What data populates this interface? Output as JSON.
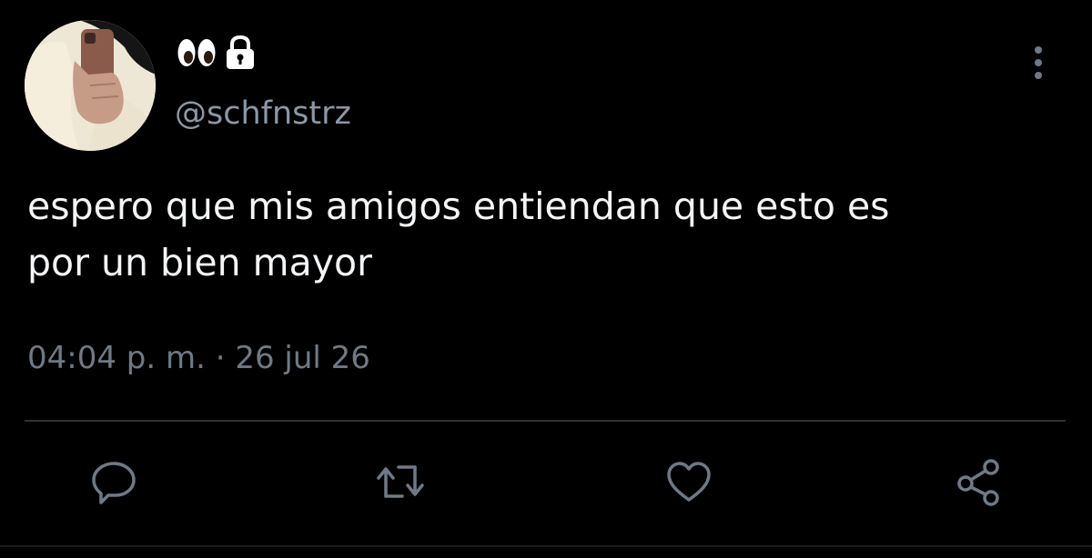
{
  "tweet": {
    "display_name_icons": [
      "eyes-icon",
      "lock-icon"
    ],
    "handle": "@schfnstrz",
    "text": "espero que mis amigos entiendan que esto es\npor un bien mayor",
    "timestamp": "04:04 p. m. · 26 jul 26"
  },
  "actions": {
    "icons": [
      "reply-icon",
      "retweet-icon",
      "like-icon",
      "share-icon"
    ]
  },
  "colors": {
    "background": "#000000",
    "text": "#f3f5f7",
    "secondary_text": "#8b98a5",
    "timestamp": "#6e7a86",
    "divider": "#2f3336",
    "icon": "#6e7a86"
  }
}
